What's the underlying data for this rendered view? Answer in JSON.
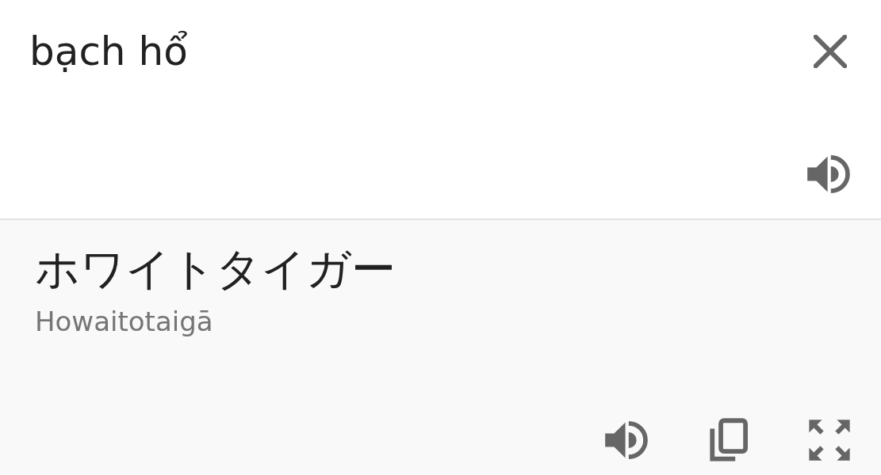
{
  "source": {
    "value": "bạch hổ"
  },
  "translation": {
    "text": "ホワイトタイガー",
    "romanization": "Howaitotaigā"
  }
}
